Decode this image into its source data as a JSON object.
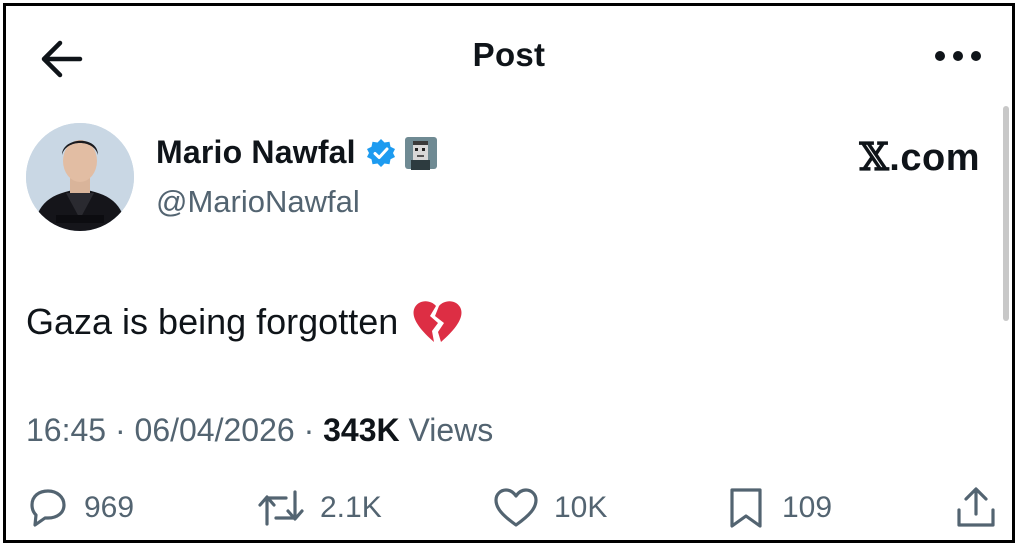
{
  "header": {
    "title": "Post"
  },
  "author": {
    "name": "Mario Nawfal",
    "handle": "@MarioNawfal"
  },
  "watermark": {
    "x_glyph": "𝕏",
    "text": ".com"
  },
  "post": {
    "text": "Gaza is being forgotten",
    "emoji": "broken-heart"
  },
  "meta": {
    "time": "16:45",
    "sep1": " · ",
    "date": "06/04/2026",
    "sep2": " · ",
    "views_count": "343K",
    "views_label": " Views"
  },
  "actions": {
    "replies": "969",
    "reposts": "2.1K",
    "likes": "10K",
    "bookmarks": "109"
  },
  "colors": {
    "text": "#0f1419",
    "secondary": "#536471",
    "verified": "#1d9bf0",
    "emoji_red": "#dd2e44"
  },
  "icons": [
    "back-arrow-icon",
    "more-icon",
    "verified-badge-icon",
    "nft-avatar-icon",
    "broken-heart-emoji-icon",
    "reply-icon",
    "repost-icon",
    "like-icon",
    "bookmark-icon",
    "share-icon"
  ]
}
